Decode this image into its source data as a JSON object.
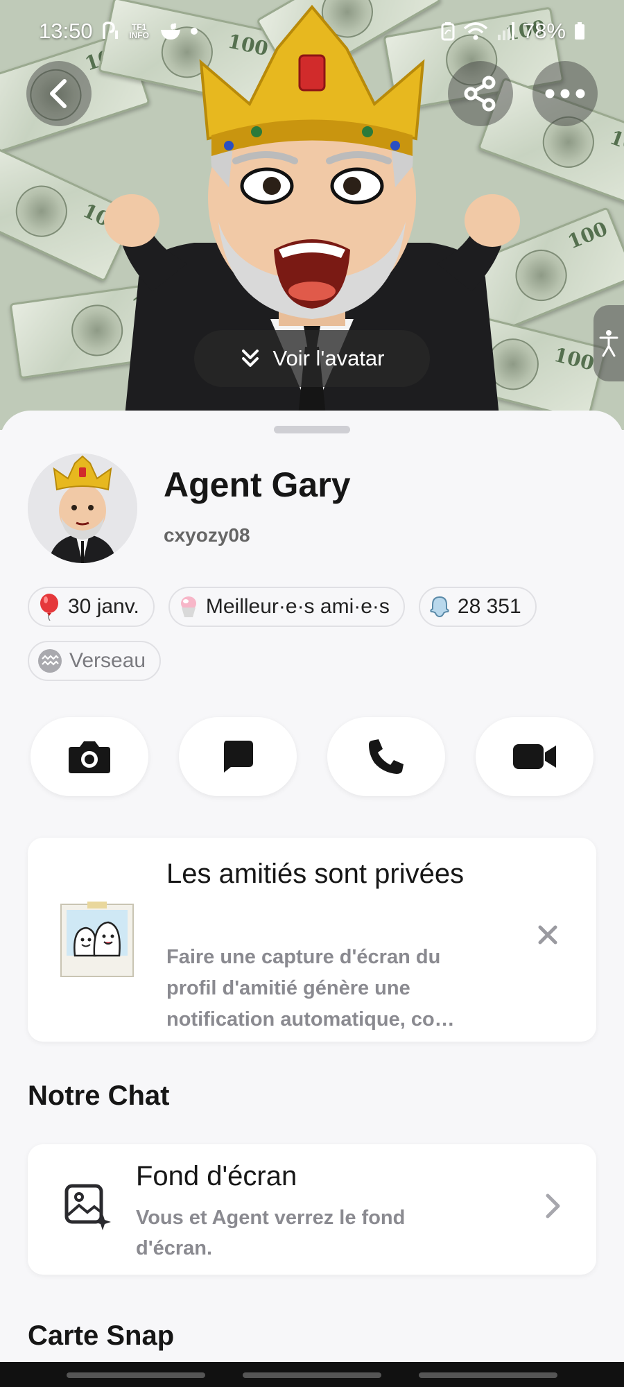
{
  "status_bar": {
    "time": "13:50",
    "info_badge": "TF1 INFO",
    "battery": "78%"
  },
  "hero": {
    "view_avatar_label": "Voir l'avatar",
    "icons": {
      "back": "chevron-left-icon",
      "share": "share-icon",
      "more": "more-dots-icon",
      "accessibility": "accessibility-icon"
    }
  },
  "profile": {
    "display_name": "Agent Gary",
    "username": "cxyozy08"
  },
  "chips": [
    {
      "icon": "balloon-icon",
      "label": "30 janv."
    },
    {
      "icon": "shaved-ice-icon",
      "label": "Meilleur·e·s ami·e·s"
    },
    {
      "icon": "ghost-icon",
      "label": "28 351"
    },
    {
      "icon": "aquarius-icon",
      "label": "Verseau"
    }
  ],
  "actions": [
    {
      "name": "camera-button",
      "icon": "camera-icon"
    },
    {
      "name": "chat-button",
      "icon": "chat-icon"
    },
    {
      "name": "call-button",
      "icon": "phone-icon"
    },
    {
      "name": "video-call-button",
      "icon": "video-camera-icon"
    }
  ],
  "friendship_card": {
    "title": "Les amitiés sont privées",
    "description": "Faire une capture d'écran du profil d'amitié génère une notification automatique, co…"
  },
  "chat_section": {
    "title": "Notre Chat",
    "wallpaper": {
      "title": "Fond d'écran",
      "description": "Vous et Agent verrez le fond d'écran."
    }
  },
  "snap_map_section": {
    "title": "Carte Snap"
  },
  "colors": {
    "sheet_bg": "#f7f7f9",
    "card_bg": "#ffffff",
    "secondary_text": "#8a8a90",
    "primary_text": "#161616"
  }
}
